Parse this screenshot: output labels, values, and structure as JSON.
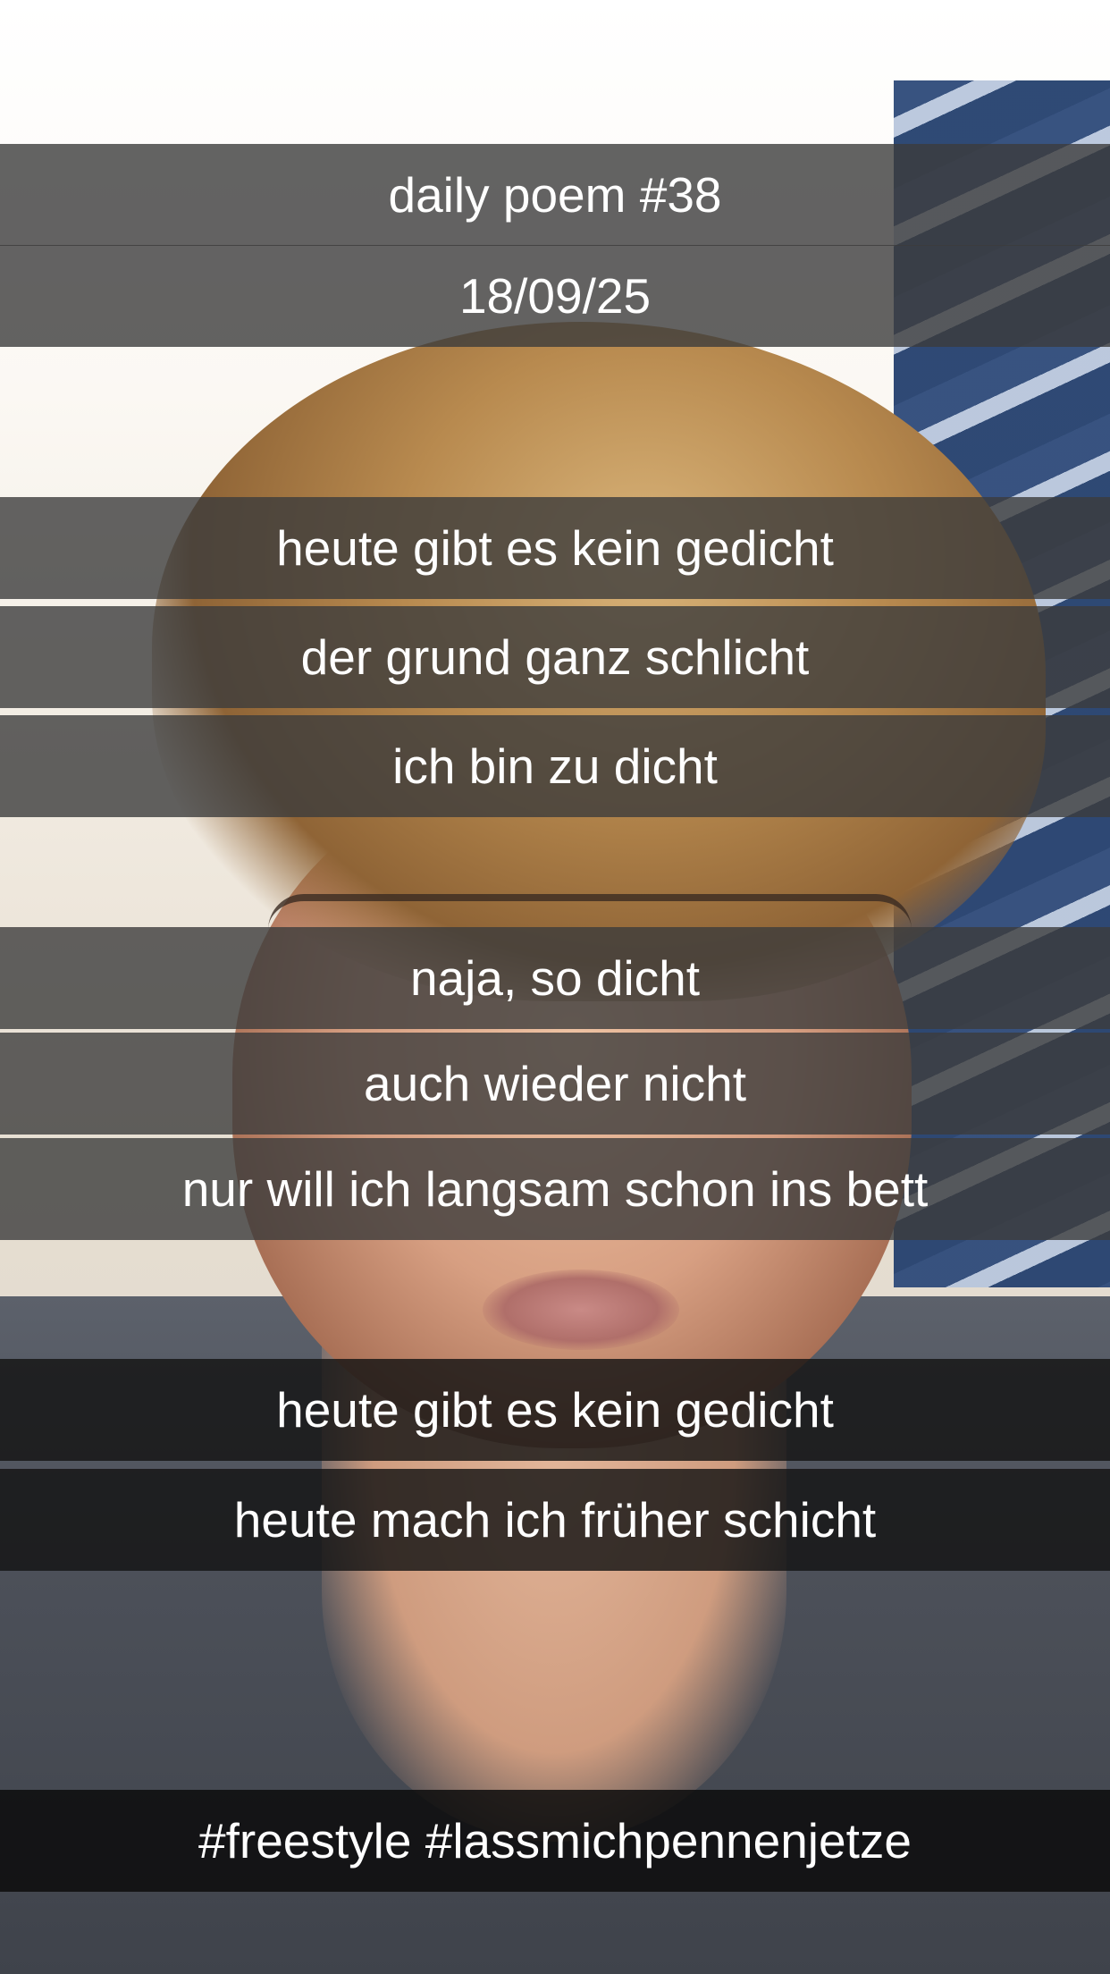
{
  "post": {
    "title": "daily poem #38",
    "date": "18/09/25",
    "stanzas": [
      [
        "heute gibt es kein gedicht",
        "der grund ganz schlicht",
        "ich bin zu dicht"
      ],
      [
        "naja, so dicht",
        "auch wieder nicht",
        "nur will ich langsam schon ins bett"
      ],
      [
        "heute gibt es kein gedicht",
        "heute mach ich früher schicht"
      ]
    ],
    "hashtags": "#freestyle #lassmichpennenjetze"
  },
  "colors": {
    "caption_bar": "#3c3c3c",
    "caption_bar_dark": "#141414",
    "caption_text": "#ffffff"
  }
}
